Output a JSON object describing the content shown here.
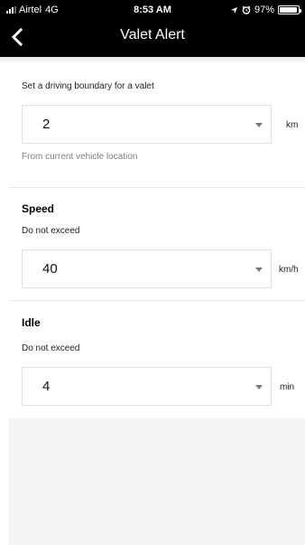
{
  "status_bar": {
    "carrier": "Airtel",
    "network": "4G",
    "time": "8:53 AM",
    "battery": "97%",
    "battery_level": 0.97
  },
  "nav": {
    "title": "Valet Alert",
    "back_icon": "chevron-left-icon"
  },
  "boundary": {
    "caption": "Set a driving boundary for a valet",
    "value": "2",
    "unit": "km",
    "hint": "From current vehicle location"
  },
  "speed": {
    "heading": "Speed",
    "caption": "Do not exceed",
    "value": "40",
    "unit": "km/h"
  },
  "idle": {
    "heading": "Idle",
    "caption": "Do not exceed",
    "value": "4",
    "unit": "min"
  }
}
